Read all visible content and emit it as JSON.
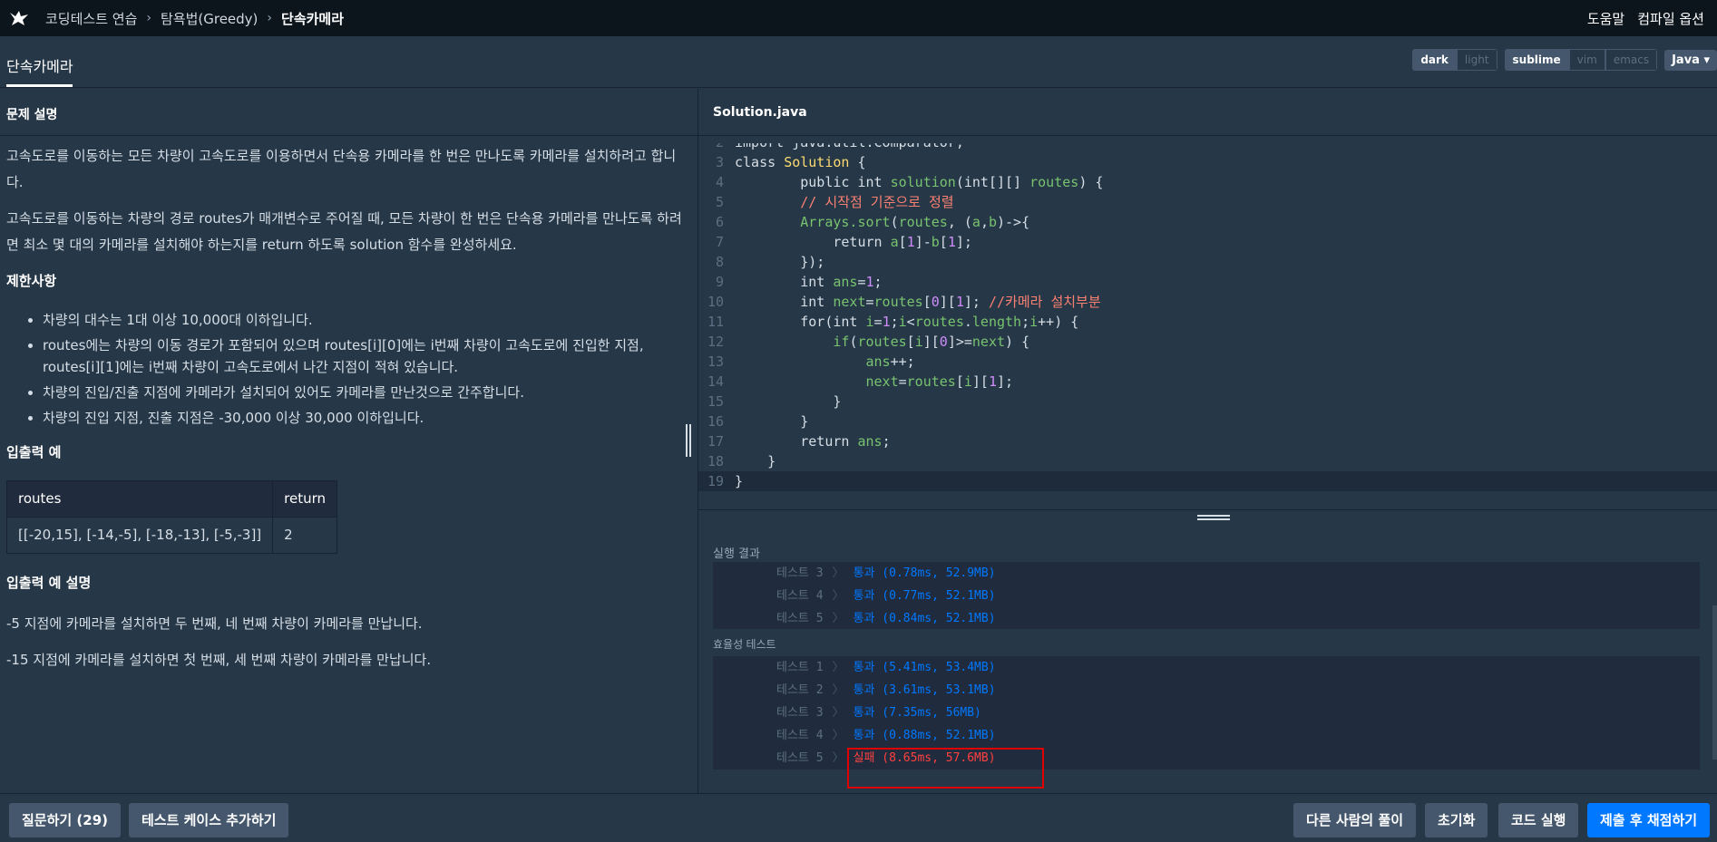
{
  "topbar": {
    "breadcrumb": [
      "코딩테스트 연습",
      "탐욕법(Greedy)",
      "단속카메라"
    ],
    "help": "도움말",
    "compile_options": "컴파일 옵션"
  },
  "tabbar": {
    "tab": "단속카메라",
    "theme_options": [
      "dark",
      "light"
    ],
    "keymap_options": [
      "sublime",
      "vim",
      "emacs"
    ],
    "language": "Java"
  },
  "problem": {
    "header": "문제 설명",
    "p1": "고속도로를 이동하는 모든 차량이 고속도로를 이용하면서 단속용 카메라를 한 번은 만나도록 카메라를 설치하려고 합니다.",
    "p2": "고속도로를 이동하는 차량의 경로 routes가 매개변수로 주어질 때, 모든 차량이 한 번은 단속용 카메라를 만나도록 하려면 최소 몇 대의 카메라를 설치해야 하는지를 return 하도록 solution 함수를 완성하세요.",
    "constraints_title": "제한사항",
    "constraints": [
      "차량의 대수는 1대 이상 10,000대 이하입니다.",
      "routes에는 차량의 이동 경로가 포함되어 있으며 routes[i][0]에는 i번째 차량이 고속도로에 진입한 지점, routes[i][1]에는 i번째 차량이 고속도로에서 나간 지점이 적혀 있습니다.",
      "차량의 진입/진출 지점에 카메라가 설치되어 있어도 카메라를 만난것으로 간주합니다.",
      "차량의 진입 지점, 진출 지점은 -30,000 이상 30,000 이하입니다."
    ],
    "examples_title": "입출력 예",
    "table_headers": [
      "routes",
      "return"
    ],
    "table_row": [
      "[[-20,15], [-14,-5], [-18,-13], [-5,-3]]",
      "2"
    ],
    "explain_title": "입출력 예 설명",
    "explain": [
      "-5 지점에 카메라를 설치하면 두 번째, 네 번째 차량이 카메라를 만납니다.",
      "-15 지점에 카메라를 설치하면 첫 번째, 세 번째 차량이 카메라를 만납니다."
    ]
  },
  "editor": {
    "filename": "Solution.java",
    "line_numbers": [
      "2",
      "3",
      "4",
      "5",
      "6",
      "7",
      "8",
      "9",
      "10",
      "11",
      "12",
      "13",
      "14",
      "15",
      "16",
      "17",
      "18",
      "19"
    ]
  },
  "results": {
    "header": "실행 결과",
    "accuracy_rows": [
      {
        "label": "테스트 3",
        "result": "통과 (0.78ms, 52.9MB)"
      },
      {
        "label": "테스트 4",
        "result": "통과 (0.77ms, 52.1MB)"
      },
      {
        "label": "테스트 5",
        "result": "통과 (0.84ms, 52.1MB)"
      }
    ],
    "efficiency_label": "효율성  테스트",
    "efficiency_rows": [
      {
        "label": "테스트 1",
        "result": "통과 (5.41ms, 53.4MB)"
      },
      {
        "label": "테스트 2",
        "result": "통과 (3.61ms, 53.1MB)"
      },
      {
        "label": "테스트 3",
        "result": "통과 (7.35ms, 56MB)"
      },
      {
        "label": "테스트 4",
        "result": "통과 (0.88ms, 52.1MB)"
      },
      {
        "label": "테스트 5",
        "result": "실패 (8.65ms, 57.6MB)"
      }
    ]
  },
  "bottom": {
    "ask": "질문하기 (29)",
    "add_test": "테스트 케이스 추가하기",
    "others": "다른 사람의 풀이",
    "reset": "초기화",
    "run": "코드 실행",
    "submit": "제출 후 채점하기"
  },
  "colors": {
    "accent": "#0078ff",
    "fail": "#ff4040",
    "highlight_box": "#e00000"
  }
}
